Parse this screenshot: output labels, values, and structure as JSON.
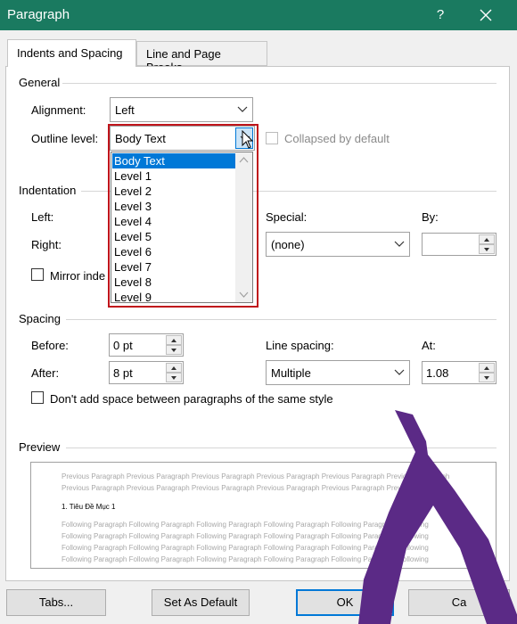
{
  "window": {
    "title": "Paragraph",
    "help_label": "?",
    "close_icon": "close-icon"
  },
  "tabs": [
    {
      "label": "Indents and Spacing",
      "active": true
    },
    {
      "label": "Line and Page Breaks",
      "active": false
    }
  ],
  "general": {
    "heading": "General",
    "alignment_label": "Alignment:",
    "alignment_value": "Left",
    "outline_label": "Outline level:",
    "outline_value": "Body Text",
    "collapsed_label": "Collapsed by default",
    "outline_options": [
      "Body Text",
      "Level 1",
      "Level 2",
      "Level 3",
      "Level 4",
      "Level 5",
      "Level 6",
      "Level 7",
      "Level 8",
      "Level 9"
    ]
  },
  "indentation": {
    "heading": "Indentation",
    "left_label": "Left:",
    "right_label": "Right:",
    "special_label": "Special:",
    "special_value": "(none)",
    "by_label": "By:",
    "by_value": "",
    "mirror_label": "Mirror inde"
  },
  "spacing": {
    "heading": "Spacing",
    "before_label": "Before:",
    "before_value": "0 pt",
    "after_label": "After:",
    "after_value": "8 pt",
    "line_spacing_label": "Line spacing:",
    "line_spacing_value": "Multiple",
    "at_label": "At:",
    "at_value": "1.08",
    "dont_add_label": "Don't add space between paragraphs of the same style"
  },
  "preview": {
    "heading": "Preview",
    "previous_lines": [
      "Previous Paragraph Previous Paragraph Previous Paragraph Previous Paragraph Previous Paragraph Previous Paragraph",
      "Previous Paragraph Previous Paragraph Previous Paragraph Previous Paragraph Previous Paragraph Previous Paragraph"
    ],
    "sample": "1. Tiêu Đề Mục 1",
    "following_lines": [
      "Following Paragraph Following Paragraph Following Paragraph Following Paragraph Following Paragraph Following",
      "Following Paragraph Following Paragraph Following Paragraph Following Paragraph Following Paragraph Following",
      "Following Paragraph Following Paragraph Following Paragraph Following Paragraph Following Paragraph Following",
      "Following Paragraph Following Paragraph Following Paragraph Following Paragraph Following Paragraph Following"
    ]
  },
  "buttons": {
    "tabs": "Tabs...",
    "set_default": "Set As Default",
    "ok": "OK",
    "cancel": "Ca"
  },
  "colors": {
    "titlebar": "#1a7a60",
    "selection": "#0078d7",
    "highlight_outline": "#c0141b",
    "logo": "#5b2a86"
  }
}
